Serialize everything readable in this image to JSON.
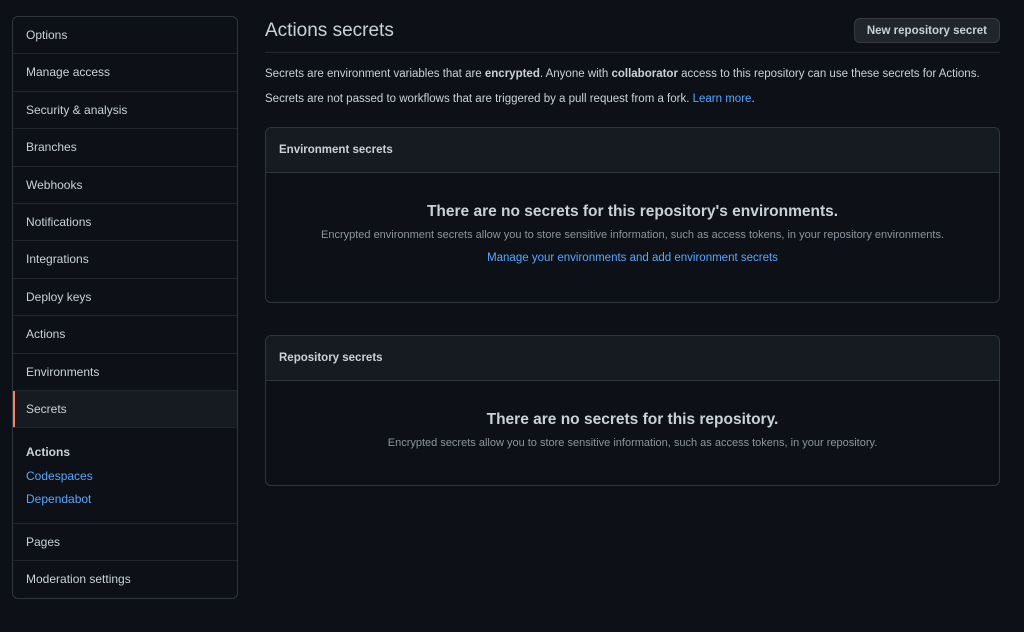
{
  "sidebar": {
    "items": [
      {
        "label": "Options"
      },
      {
        "label": "Manage access"
      },
      {
        "label": "Security & analysis"
      },
      {
        "label": "Branches"
      },
      {
        "label": "Webhooks"
      },
      {
        "label": "Notifications"
      },
      {
        "label": "Integrations"
      },
      {
        "label": "Deploy keys"
      },
      {
        "label": "Actions"
      },
      {
        "label": "Environments"
      },
      {
        "label": "Secrets"
      }
    ],
    "secrets_group": {
      "title": "Actions",
      "links": [
        {
          "label": "Codespaces"
        },
        {
          "label": "Dependabot"
        }
      ]
    },
    "bottom_items": [
      {
        "label": "Pages"
      },
      {
        "label": "Moderation settings"
      }
    ],
    "selected_accent": "#f78166"
  },
  "main": {
    "title": "Actions secrets",
    "new_secret_button": "New repository secret",
    "description1": {
      "part1": "Secrets are environment variables that are ",
      "bold1": "encrypted",
      "part2": ". Anyone with ",
      "bold2": "collaborator",
      "part3": " access to this repository can use these secrets for Actions."
    },
    "description2": {
      "text": "Secrets are not passed to workflows that are triggered by a pull request from a fork. ",
      "link": "Learn more",
      "end": "."
    },
    "environment_secrets": {
      "header": "Environment secrets",
      "empty_title": "There are no secrets for this repository's environments.",
      "empty_desc": "Encrypted environment secrets allow you to store sensitive information, such as access tokens, in your repository environments.",
      "empty_link": "Manage your environments and add environment secrets"
    },
    "repository_secrets": {
      "header": "Repository secrets",
      "empty_title": "There are no secrets for this repository.",
      "empty_desc": "Encrypted secrets allow you to store sensitive information, such as access tokens, in your repository."
    }
  },
  "colors": {
    "background": "#0d1117",
    "border": "#30363d",
    "link": "#58a6ff",
    "muted_text": "#8b949e"
  }
}
